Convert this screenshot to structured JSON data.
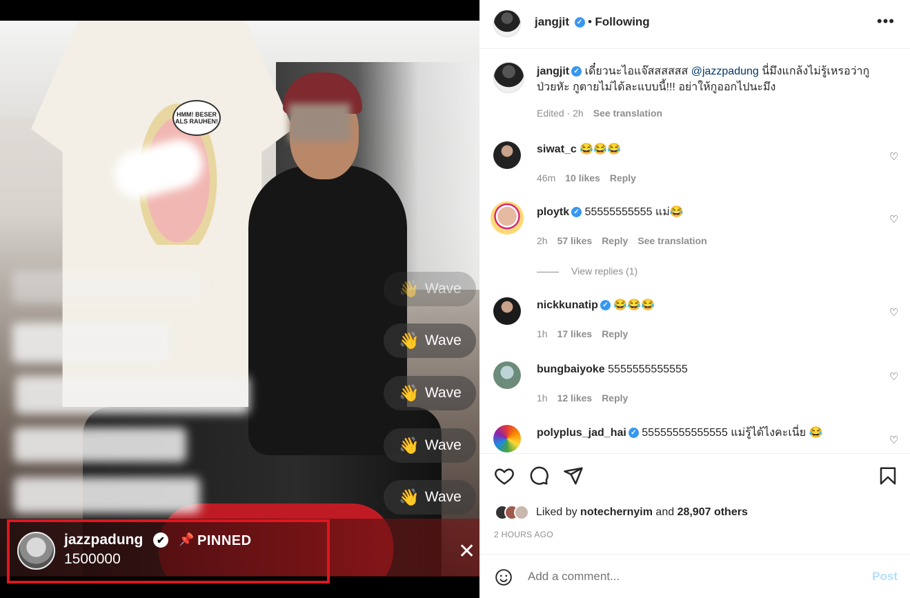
{
  "media": {
    "shirt_speech": "HMM! BESER ALS RAUHEN!",
    "wave_label": "Wave",
    "wave_emoji": "👋",
    "pinned": {
      "username": "jazzpadung",
      "label": "PINNED",
      "text": "1500000",
      "pin_icon": "📌",
      "verified_glyph": "✔",
      "close_glyph": "✕"
    }
  },
  "post": {
    "author": "jangjit",
    "follow_status": "Following",
    "dot": "•",
    "more": "•••",
    "caption": {
      "username": "jangjit",
      "text_before": "เดี๋ยวนะไอแจ๊สสสสสส ",
      "mention": "@jazzpadung",
      "text_after": " นี่มึงแกล้งไม่รู้เหรอว่ากูป่วยหัะ กูตายไม่ได้ละแบบนี้!!! อย่าให้กูออกไปนะมึง",
      "meta_time": "Edited · 2h",
      "see_translation": "See translation"
    },
    "comments": [
      {
        "username": "siwat_c",
        "verified": false,
        "text": "😂😂😂",
        "time": "46m",
        "likes": "10 likes",
        "reply": "Reply"
      },
      {
        "username": "ploytk",
        "verified": true,
        "text": "55555555555 แม่😂",
        "time": "2h",
        "likes": "57 likes",
        "reply": "Reply",
        "see_translation": "See translation",
        "view_replies": "View replies (1)"
      },
      {
        "username": "nickkunatip",
        "verified": true,
        "text": "😂😂😂",
        "time": "1h",
        "likes": "17 likes",
        "reply": "Reply"
      },
      {
        "username": "bungbaiyoke",
        "verified": false,
        "text": "5555555555555",
        "time": "1h",
        "likes": "12 likes",
        "reply": "Reply"
      },
      {
        "username": "polyplus_jad_hai",
        "verified": true,
        "text": "55555555555555 แม่รู้ได้ไงคะเนี่ย 😂",
        "time": "",
        "likes": "",
        "reply": ""
      }
    ],
    "liked_by_prefix": "Liked by ",
    "liked_by_user": "notechernyim",
    "liked_by_and": " and ",
    "liked_by_others": "28,907 others",
    "timestamp": "2 HOURS AGO",
    "comment_placeholder": "Add a comment...",
    "post_button": "Post"
  },
  "colors": {
    "verified": "#3897f0",
    "pin_highlight": "#e0161e",
    "post_button": "#b2dffc"
  }
}
